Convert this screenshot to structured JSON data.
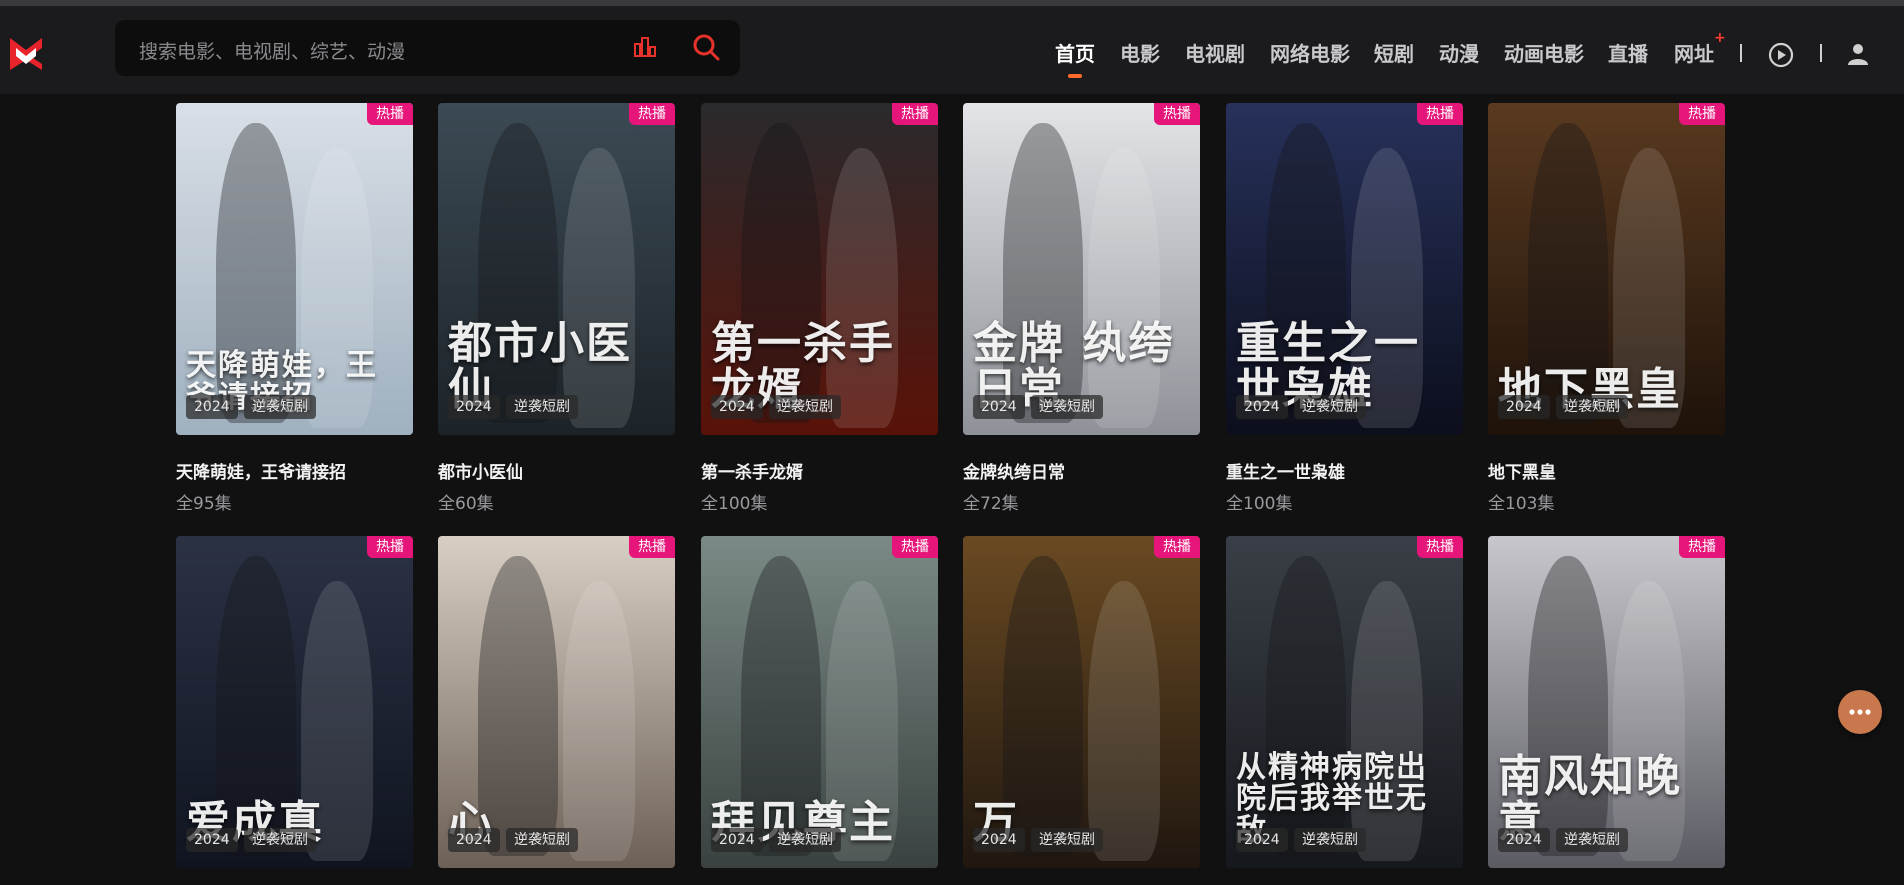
{
  "search": {
    "placeholder": "搜索电影、电视剧、综艺、动漫"
  },
  "nav": {
    "items": [
      {
        "label": "首页",
        "active": true
      },
      {
        "label": "电影"
      },
      {
        "label": "电视剧"
      },
      {
        "label": "网络电影"
      },
      {
        "label": "短剧"
      },
      {
        "label": "动漫"
      },
      {
        "label": "动画电影"
      },
      {
        "label": "直播"
      },
      {
        "label": "网址"
      }
    ],
    "url_mark": "+"
  },
  "colors": {
    "accent": "#ff6a2a",
    "hot_badge": "#e5157a",
    "logo_red": "#e8232c"
  },
  "icons": {
    "logo": "brand-logo",
    "hot": "ranking-icon",
    "search": "search-icon",
    "history": "play-history-icon",
    "user": "user-icon",
    "more": "more-icon"
  },
  "cards": [
    {
      "badge": "热播",
      "year": "2024",
      "genre": "逆袭短剧",
      "title": "天降萌娃，王爷请接招",
      "episodes": "全95集",
      "art": "天降萌娃，王爷请接招",
      "bg": [
        "#d9dfe6",
        "#9fb0bf"
      ]
    },
    {
      "badge": "热播",
      "year": "2024",
      "genre": "逆袭短剧",
      "title": "都市小医仙",
      "episodes": "全60集",
      "art": "都市小医仙",
      "bg": [
        "#3c4a55",
        "#1c2328"
      ]
    },
    {
      "badge": "热播",
      "year": "2024",
      "genre": "逆袭短剧",
      "title": "第一杀手龙婿",
      "episodes": "全100集",
      "art": "第一杀手 龙婿",
      "bg": [
        "#2a2a2d",
        "#5a1208"
      ]
    },
    {
      "badge": "热播",
      "year": "2024",
      "genre": "逆袭短剧",
      "title": "金牌纨绔日常",
      "episodes": "全72集",
      "art": "金牌 纨绔日常",
      "bg": [
        "#e3e5e8",
        "#8e9298"
      ]
    },
    {
      "badge": "热播",
      "year": "2024",
      "genre": "逆袭短剧",
      "title": "重生之一世枭雄",
      "episodes": "全100集",
      "art": "重生之一世枭雄",
      "bg": [
        "#27315a",
        "#0c0e1c"
      ]
    },
    {
      "badge": "热播",
      "year": "2024",
      "genre": "逆袭短剧",
      "title": "地下黑皇",
      "episodes": "全103集",
      "art": "地下黑皇",
      "bg": [
        "#5a3a20",
        "#1e120a"
      ]
    },
    {
      "badge": "热播",
      "year": "2024",
      "genre": "逆袭短剧",
      "title": "",
      "episodes": "",
      "art": "爱成真",
      "bg": [
        "#2b3244",
        "#101420"
      ]
    },
    {
      "badge": "热播",
      "year": "2024",
      "genre": "逆袭短剧",
      "title": "",
      "episodes": "",
      "art": "心",
      "bg": [
        "#d8cfc4",
        "#6d6157"
      ]
    },
    {
      "badge": "热播",
      "year": "2024",
      "genre": "逆袭短剧",
      "title": "",
      "episodes": "",
      "art": "拜见尊主",
      "bg": [
        "#7b8a86",
        "#394240"
      ]
    },
    {
      "badge": "热播",
      "year": "2024",
      "genre": "逆袭短剧",
      "title": "",
      "episodes": "",
      "art": "万",
      "bg": [
        "#6a4a22",
        "#201710"
      ]
    },
    {
      "badge": "热播",
      "year": "2024",
      "genre": "逆袭短剧",
      "title": "",
      "episodes": "",
      "art": "从精神病院出院后我举世无敌",
      "bg": [
        "#3a3f47",
        "#15181c"
      ]
    },
    {
      "badge": "热播",
      "year": "2024",
      "genre": "逆袭短剧",
      "title": "",
      "episodes": "",
      "art": "南风知晚意",
      "bg": [
        "#c7c7cc",
        "#5b5b63"
      ]
    }
  ]
}
